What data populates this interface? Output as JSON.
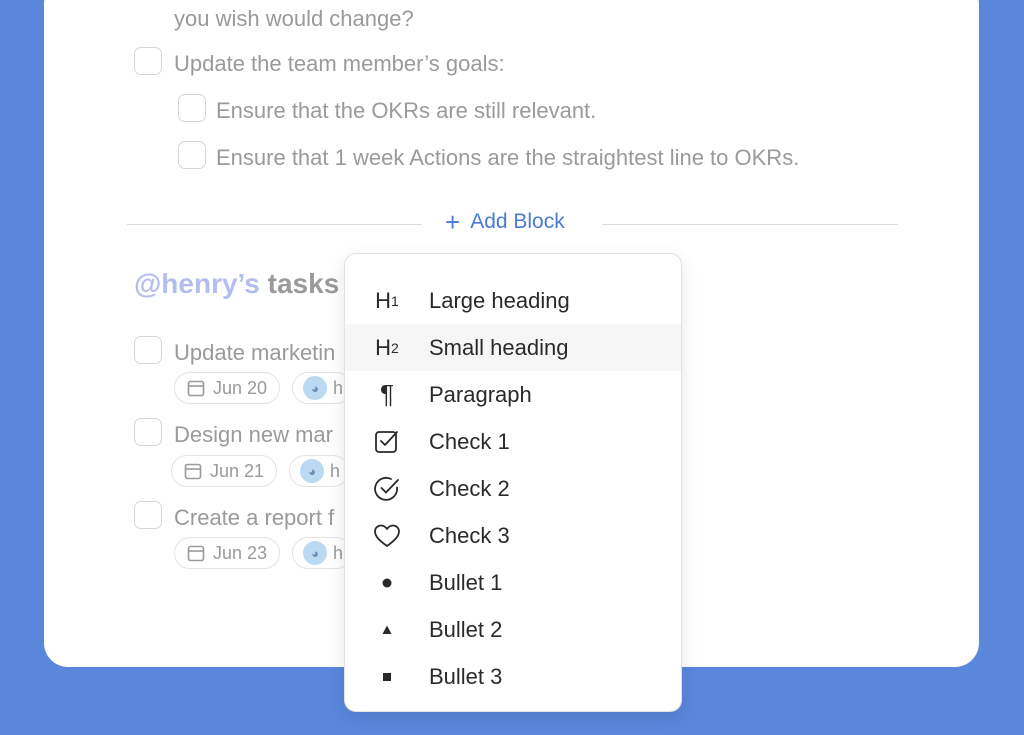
{
  "checklist": {
    "line_top": "you wish would change?",
    "item_goals": "Update the team member’s goals:",
    "sub_item_1": "Ensure that the OKRs are still relevant.",
    "sub_item_2": "Ensure that 1 week Actions are the straightest line to OKRs."
  },
  "add_block": {
    "plus": "+",
    "label": "Add Block"
  },
  "section": {
    "mention": "@henry’s",
    "tasks": " tasks"
  },
  "tasks": [
    {
      "title": "Update marketin",
      "date": "Jun 20",
      "assignee_initial": "h"
    },
    {
      "title": "Design new mar",
      "date": "Jun 21",
      "assignee_initial": "h"
    },
    {
      "title": "Create a report f",
      "date": "Jun 23",
      "assignee_initial": "h"
    }
  ],
  "menu": {
    "items": [
      {
        "icon": "h1-icon",
        "glyph": "H",
        "sub": "1",
        "label": "Large heading"
      },
      {
        "icon": "h2-icon",
        "glyph": "H",
        "sub": "2",
        "label": "Small heading"
      },
      {
        "icon": "paragraph-icon",
        "glyph": "¶",
        "label": "Paragraph"
      },
      {
        "icon": "checkbox-checked-icon",
        "label": "Check 1"
      },
      {
        "icon": "circle-check-icon",
        "label": "Check 2"
      },
      {
        "icon": "heart-icon",
        "label": "Check 3"
      },
      {
        "icon": "bullet-dot-icon",
        "label": "Bullet 1"
      },
      {
        "icon": "bullet-triangle-icon",
        "label": "Bullet 2"
      },
      {
        "icon": "bullet-square-icon",
        "label": "Bullet 3"
      }
    ],
    "hovered_index": 1
  },
  "colors": {
    "background": "#5a87dc",
    "accent": "#4a7ad6",
    "mention": "#b4bdf0",
    "muted_text": "#9a9a9a"
  }
}
